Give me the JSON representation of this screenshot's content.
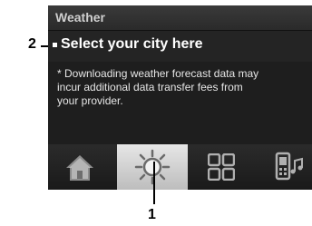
{
  "app": {
    "title": "Weather"
  },
  "weather": {
    "select_city": "Select your city here",
    "notice_lines": [
      "* Downloading weather forecast data may",
      "incur additional data transfer fees from",
      "your provider."
    ]
  },
  "tabs": [
    {
      "name": "home",
      "icon": "house-icon",
      "selected": false
    },
    {
      "name": "weather",
      "icon": "sun-icon",
      "selected": true
    },
    {
      "name": "apps",
      "icon": "grid-icon",
      "selected": false
    },
    {
      "name": "music",
      "icon": "phone-music-icon",
      "selected": false
    }
  ],
  "callouts": {
    "city_marker": "2",
    "weather_tab_marker": "1"
  },
  "colors": {
    "screen_bg": "#1e1e1e",
    "selected_tab": "#d9d9d9",
    "icon": "#bfbfbf"
  }
}
